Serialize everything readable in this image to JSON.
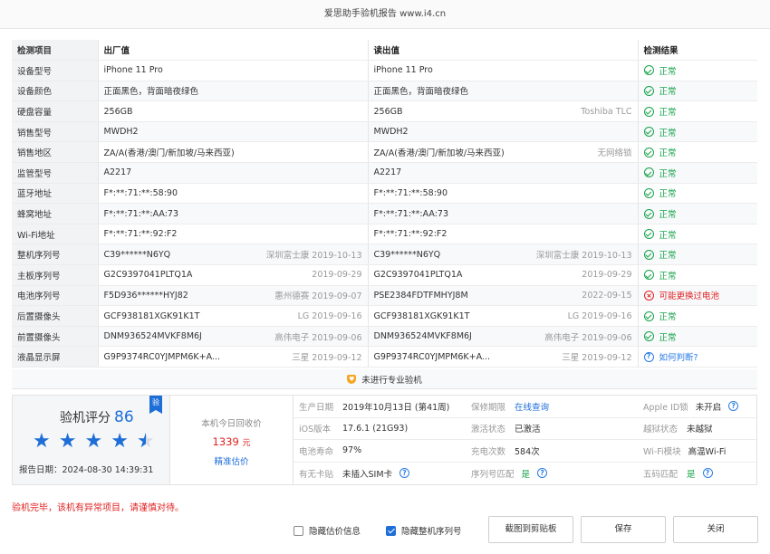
{
  "window": {
    "title": "爱思助手验机报告 www.i4.cn"
  },
  "table": {
    "headers": {
      "item": "检测项目",
      "factory": "出厂值",
      "read": "读出值",
      "result": "检测结果"
    },
    "rows": [
      {
        "name": "设备型号",
        "factory": "iPhone 11 Pro",
        "factory_note": "",
        "read": "iPhone 11 Pro",
        "read_note": "",
        "status": "ok",
        "result": "正常"
      },
      {
        "name": "设备颜色",
        "factory": "正面黑色，背面暗夜绿色",
        "factory_note": "",
        "read": "正面黑色，背面暗夜绿色",
        "read_note": "",
        "status": "ok",
        "result": "正常"
      },
      {
        "name": "硬盘容量",
        "factory": "256GB",
        "factory_note": "",
        "read": "256GB",
        "read_note": "Toshiba TLC",
        "status": "ok",
        "result": "正常"
      },
      {
        "name": "销售型号",
        "factory": "MWDH2",
        "factory_note": "",
        "read": "MWDH2",
        "read_note": "",
        "status": "ok",
        "result": "正常"
      },
      {
        "name": "销售地区",
        "factory": "ZA/A(香港/澳门/新加坡/马来西亚)",
        "factory_note": "",
        "read": "ZA/A(香港/澳门/新加坡/马来西亚)",
        "read_note": "无网络锁",
        "status": "ok",
        "result": "正常"
      },
      {
        "name": "监管型号",
        "factory": "A2217",
        "factory_note": "",
        "read": "A2217",
        "read_note": "",
        "status": "ok",
        "result": "正常"
      },
      {
        "name": "蓝牙地址",
        "factory": "F*:**:71:**:58:90",
        "factory_note": "",
        "read": "F*:**:71:**:58:90",
        "read_note": "",
        "status": "ok",
        "result": "正常"
      },
      {
        "name": "蜂窝地址",
        "factory": "F*:**:71:**:AA:73",
        "factory_note": "",
        "read": "F*:**:71:**:AA:73",
        "read_note": "",
        "status": "ok",
        "result": "正常"
      },
      {
        "name": "Wi-Fi地址",
        "factory": "F*:**:71:**:92:F2",
        "factory_note": "",
        "read": "F*:**:71:**:92:F2",
        "read_note": "",
        "status": "ok",
        "result": "正常"
      },
      {
        "name": "整机序列号",
        "factory": "C39******N6YQ",
        "factory_note": "深圳富士康 2019-10-13",
        "read": "C39******N6YQ",
        "read_note": "深圳富士康 2019-10-13",
        "status": "ok",
        "result": "正常"
      },
      {
        "name": "主板序列号",
        "factory": "G2C9397041PLTQ1A",
        "factory_note": "2019-09-29",
        "read": "G2C9397041PLTQ1A",
        "read_note": "2019-09-29",
        "status": "ok",
        "result": "正常"
      },
      {
        "name": "电池序列号",
        "factory": "F5D936******HYJ82",
        "factory_note": "惠州德赛 2019-09-07",
        "read": "PSE2384FDTFMHYJ8M",
        "read_note": "2022-09-15",
        "status": "warn",
        "result": "可能更换过电池"
      },
      {
        "name": "后置摄像头",
        "factory": "GCF938181XGK91K1T",
        "factory_note": "LG 2019-09-16",
        "read": "GCF938181XGK91K1T",
        "read_note": "LG 2019-09-16",
        "status": "ok",
        "result": "正常"
      },
      {
        "name": "前置摄像头",
        "factory": "DNM936524MVKF8M6J",
        "factory_note": "高伟电子 2019-09-06",
        "read": "DNM936524MVKF8M6J",
        "read_note": "高伟电子 2019-09-06",
        "status": "ok",
        "result": "正常"
      },
      {
        "name": "液晶显示屏",
        "factory": "G9P9374RC0YJMPM6K+A...",
        "factory_note": "三星 2019-09-12",
        "read": "G9P9374RC0YJMPM6K+A...",
        "read_note": "三星 2019-09-12",
        "status": "ask",
        "result": "如何判断?"
      }
    ]
  },
  "notice": "未进行专业验机",
  "summary": {
    "score_label": "验机评分",
    "score": "86",
    "badge": "验",
    "stars": 4.5,
    "report_date": "报告日期：2024-08-30 14:39:31",
    "recycle_label": "本机今日回收价",
    "recycle_price": "1339",
    "recycle_unit": "元",
    "recycle_link": "精准估价",
    "grid": [
      {
        "k": "生产日期",
        "v": "2019年10月13日 (第41周)",
        "style": "",
        "q": false
      },
      {
        "k": "保修期限",
        "v": "在线查询",
        "style": "link",
        "q": false
      },
      {
        "k": "Apple ID锁",
        "v": "未开启",
        "style": "",
        "q": true
      },
      {
        "k": "iOS版本",
        "v": "17.6.1 (21G93)",
        "style": "",
        "q": false
      },
      {
        "k": "激活状态",
        "v": "已激活",
        "style": "",
        "q": false
      },
      {
        "k": "越狱状态",
        "v": "未越狱",
        "style": "",
        "q": false
      },
      {
        "k": "电池寿命",
        "v": "97%",
        "style": "",
        "q": false
      },
      {
        "k": "充电次数",
        "v": "584次",
        "style": "",
        "q": false
      },
      {
        "k": "Wi-Fi模块",
        "v": "高温Wi-Fi",
        "style": "",
        "q": false
      },
      {
        "k": "有无卡贴",
        "v": "未插入SIM卡",
        "style": "",
        "q": true
      },
      {
        "k": "序列号匹配",
        "v": "是",
        "style": "green",
        "q": true
      },
      {
        "k": "五码匹配",
        "v": "是",
        "style": "green",
        "q": true
      }
    ]
  },
  "final_message": "验机完毕，该机有异常项目，请谨慎对待。",
  "footer": {
    "hide_price": {
      "label": "隐藏估价信息",
      "checked": false
    },
    "hide_serial": {
      "label": "隐藏整机序列号",
      "checked": true
    },
    "screenshot_button": "截图到剪贴板",
    "save_button": "保存",
    "close_button": "关闭"
  },
  "colors": {
    "ok": "#16a34a",
    "warn": "#e02020",
    "link": "#1e6ed8"
  }
}
